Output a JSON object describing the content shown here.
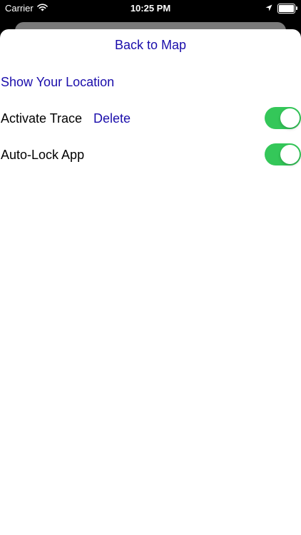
{
  "status_bar": {
    "carrier": "Carrier",
    "time": "10:25 PM",
    "icons": [
      "wifi-icon",
      "location-arrow-icon",
      "battery-icon"
    ]
  },
  "sheet": {
    "back_label": "Back to Map",
    "show_location_label": "Show Your Location",
    "trace": {
      "label": "Activate Trace",
      "delete_label": "Delete",
      "on": true
    },
    "autolock": {
      "label": "Auto-Lock App",
      "on": true
    }
  },
  "colors": {
    "link": "#1a0dab",
    "toggle_on": "#34c759",
    "sheet_bg": "#ffffff",
    "behind_card": "#7a7a7a"
  }
}
